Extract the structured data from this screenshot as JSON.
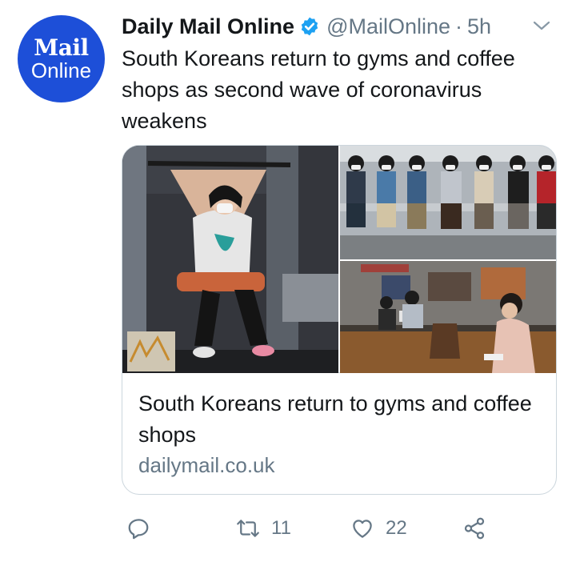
{
  "tweet": {
    "avatar": {
      "line1": "Mail",
      "line2": "Online",
      "color": "#1d4fd8"
    },
    "author": {
      "display_name": "Daily Mail Online",
      "handle": "@MailOnline",
      "separator": "·",
      "time": "5h",
      "verified": true
    },
    "text": "South Koreans return to gyms and coffee shops as second wave of coronavirus weakens",
    "card": {
      "title": "South Koreans return to gyms and coffee shops",
      "domain": "dailymail.co.uk",
      "images": [
        "woman-at-gym-photo",
        "subway-passengers-photo",
        "coffee-shop-photo"
      ]
    },
    "actions": {
      "reply_icon": "reply-icon",
      "retweet_icon": "retweet-icon",
      "retweet_count": "11",
      "like_icon": "heart-icon",
      "like_count": "22",
      "share_icon": "share-icon"
    }
  },
  "colors": {
    "text": "#14171a",
    "secondary": "#657786",
    "verified": "#1da1f2",
    "border": "#ccd6dd"
  }
}
